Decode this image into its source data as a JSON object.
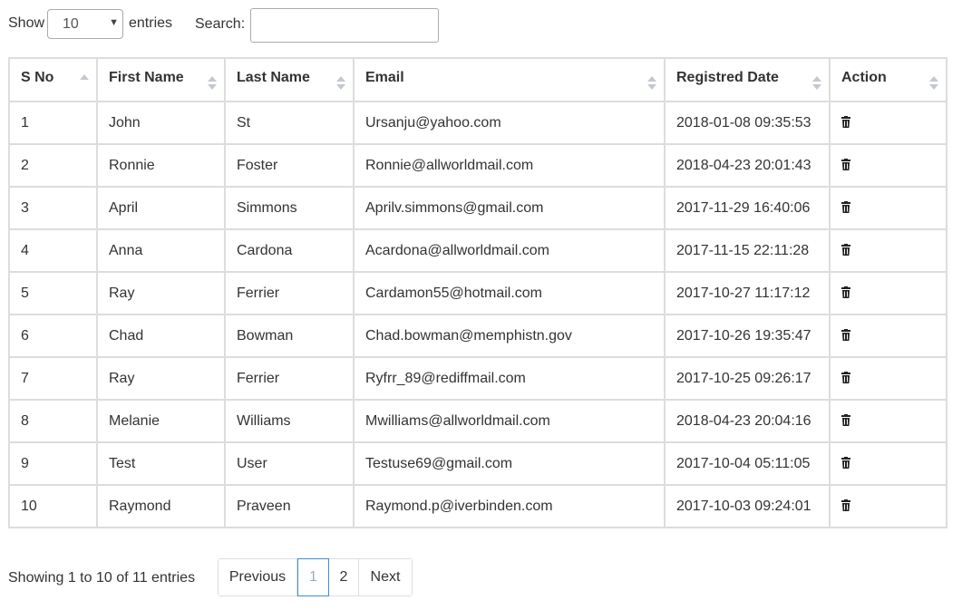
{
  "controls": {
    "show_label": "Show",
    "entries_label": "entries",
    "page_size": "10",
    "search_label": "Search:",
    "search_value": ""
  },
  "table": {
    "columns": [
      "S No",
      "First Name",
      "Last Name",
      "Email",
      "Registred Date",
      "Action"
    ],
    "rows": [
      {
        "sno": "1",
        "first": "John",
        "last": "St",
        "email": "Ursanju@yahoo.com",
        "date": "2018-01-08 09:35:53"
      },
      {
        "sno": "2",
        "first": "Ronnie",
        "last": "Foster",
        "email": "Ronnie@allworldmail.com",
        "date": "2018-04-23 20:01:43"
      },
      {
        "sno": "3",
        "first": "April",
        "last": "Simmons",
        "email": "Aprilv.simmons@gmail.com",
        "date": "2017-11-29 16:40:06"
      },
      {
        "sno": "4",
        "first": "Anna",
        "last": "Cardona",
        "email": "Acardona@allworldmail.com",
        "date": "2017-11-15 22:11:28"
      },
      {
        "sno": "5",
        "first": "Ray",
        "last": "Ferrier",
        "email": "Cardamon55@hotmail.com",
        "date": "2017-10-27 11:17:12"
      },
      {
        "sno": "6",
        "first": "Chad",
        "last": "Bowman",
        "email": "Chad.bowman@memphistn.gov",
        "date": "2017-10-26 19:35:47"
      },
      {
        "sno": "7",
        "first": "Ray",
        "last": "Ferrier",
        "email": "Ryfrr_89@rediffmail.com",
        "date": "2017-10-25 09:26:17"
      },
      {
        "sno": "8",
        "first": "Melanie",
        "last": "Williams",
        "email": "Mwilliams@allworldmail.com",
        "date": "2018-04-23 20:04:16"
      },
      {
        "sno": "9",
        "first": "Test",
        "last": "User",
        "email": "Testuse69@gmail.com",
        "date": "2017-10-04 05:11:05"
      },
      {
        "sno": "10",
        "first": "Raymond",
        "last": "Praveen",
        "email": "Raymond.p@iverbinden.com",
        "date": "2017-10-03 09:24:01"
      }
    ],
    "action_icon": "trash-icon"
  },
  "footer": {
    "info": "Showing 1 to 10 of 11 entries",
    "previous": "Previous",
    "pages": [
      "1",
      "2"
    ],
    "current_page": "1",
    "next": "Next"
  },
  "colors": {
    "border": "#dddddd",
    "active_page_border": "#3d8fd1",
    "sort_arrow": "#c3c8d0"
  }
}
